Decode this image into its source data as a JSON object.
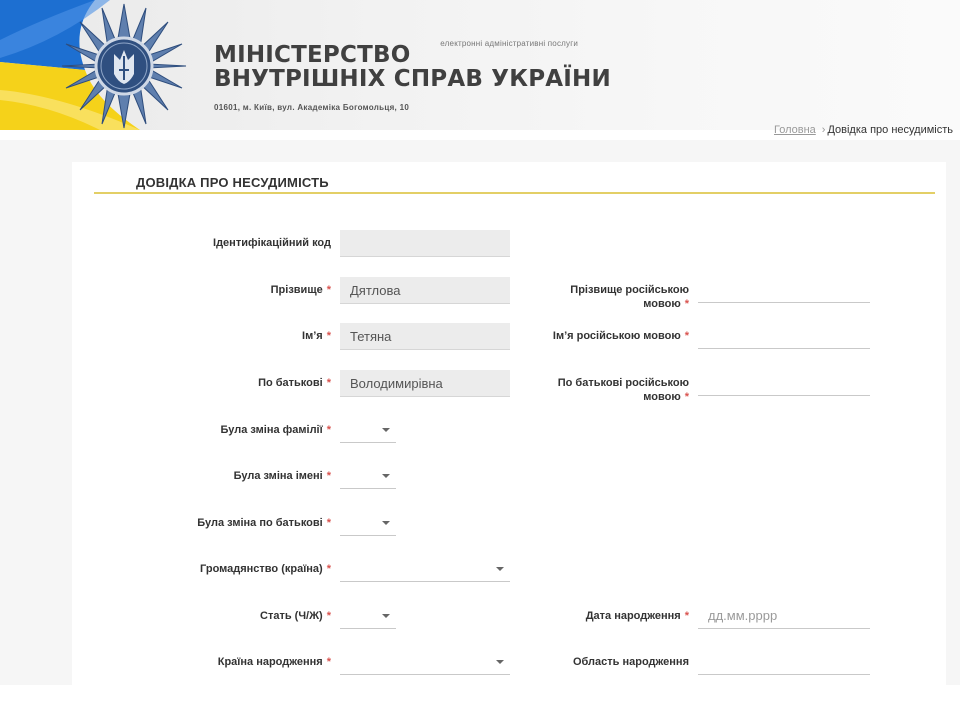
{
  "header": {
    "title_line1": "МІНІСТЕРСТВО",
    "title_line2": "ВНУТРІШНІХ СПРАВ УКРАЇНИ",
    "address": "01601, м. Київ, вул. Академіка Богомольця, 10",
    "service_tag": "електронні адміністративні послуги",
    "colors": {
      "flag_blue": "#1d6fd1",
      "flag_yellow": "#f5d21a",
      "emblem_blue": "#3b5b8c"
    }
  },
  "breadcrumb": {
    "home": "Головна",
    "separator": "›",
    "current": "Довідка про несудимість"
  },
  "page": {
    "title": "ДОВІДКА ПРО НЕСУДИМІСТЬ",
    "accent_color": "#e3cf66"
  },
  "form": {
    "required_mark": "*",
    "id_code": {
      "label": "Ідентифікаційний код",
      "value": ""
    },
    "surname": {
      "label": "Прізвище",
      "value": "Дятлова"
    },
    "surname_ru": {
      "label_line1": "Прізвище російською",
      "label_line2": "мовою",
      "value": ""
    },
    "name": {
      "label": "Ім’я",
      "value": "Тетяна"
    },
    "name_ru": {
      "label": "Ім’я російською мовою",
      "value": ""
    },
    "patronymic": {
      "label": "По батькові",
      "value": "Володимирівна"
    },
    "patronymic_ru": {
      "label_line1": "По батькові російською",
      "label_line2": "мовою",
      "value": ""
    },
    "surname_changed": {
      "label": "Була зміна фамілії",
      "value": ""
    },
    "name_changed": {
      "label": "Була зміна імені",
      "value": ""
    },
    "patronymic_changed": {
      "label": "Була зміна по батькові",
      "value": ""
    },
    "citizenship": {
      "label": "Громадянство (країна)",
      "value": ""
    },
    "sex": {
      "label": "Стать (Ч/Ж)",
      "value": ""
    },
    "birth_date": {
      "label": "Дата народження",
      "placeholder": "дд.мм.рррр"
    },
    "birth_country": {
      "label": "Країна народження",
      "value": ""
    },
    "birth_region": {
      "label": "Область народження",
      "value": ""
    }
  }
}
